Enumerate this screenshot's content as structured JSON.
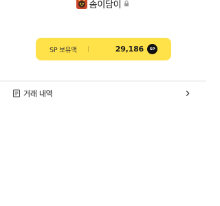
{
  "profile": {
    "nickname": "솜이담이",
    "avatar_icon": "character-avatar-icon",
    "lock_icon": "lock-icon"
  },
  "sp_card": {
    "label": "SP 보유액",
    "value": "29,186",
    "badge": "SP",
    "background_color": "#ffe14a"
  },
  "menu": {
    "items": [
      {
        "label": "거래 내역",
        "icon": "document-icon",
        "trailing_icon": "chevron-right-icon"
      }
    ]
  }
}
